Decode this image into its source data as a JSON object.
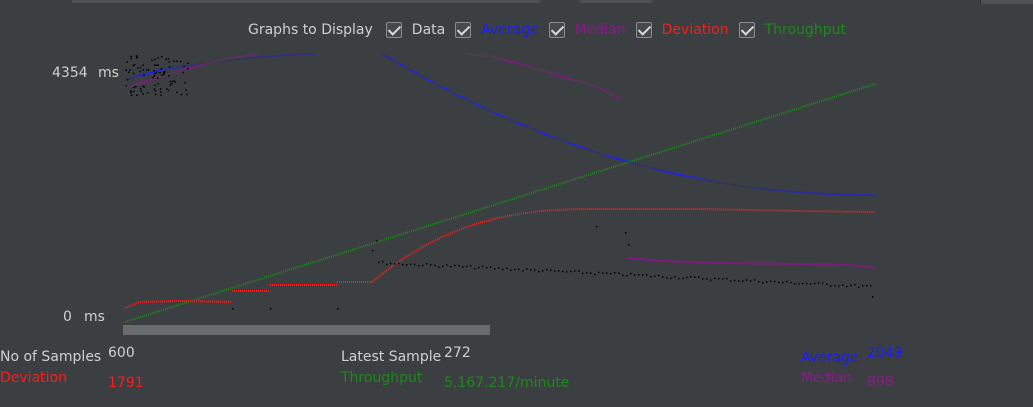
{
  "legend": {
    "title": "Graphs to Display",
    "items": [
      {
        "label": "Data",
        "checked": true,
        "color": "#cfcfcf"
      },
      {
        "label": "Average",
        "checked": true,
        "color": "#1a1aff"
      },
      {
        "label": "Median",
        "checked": true,
        "color": "#8b1a8b"
      },
      {
        "label": "Deviation",
        "checked": true,
        "color": "#ff1a1a"
      },
      {
        "label": "Throughput",
        "checked": true,
        "color": "#1a8a1a"
      }
    ]
  },
  "axis": {
    "max_value": "4354",
    "max_unit": "ms",
    "min_value": "0",
    "min_unit": "ms"
  },
  "stats": {
    "no_of_samples_label": "No of Samples",
    "no_of_samples_value": "600",
    "latest_sample_label": "Latest Sample",
    "latest_sample_value": "272",
    "average_label": "Average",
    "average_value": "2049",
    "deviation_label": "Deviation",
    "deviation_value": "1791",
    "throughput_label": "Throughput",
    "throughput_value": "5,167.217/minute",
    "median_label": "Median",
    "median_value": "898"
  },
  "colors": {
    "background": "#3c3f41",
    "data": "#000000",
    "average": "#1a1aff",
    "median": "#8b1a8b",
    "deviation": "#ff1a1a",
    "throughput": "#1a8a1a"
  }
}
